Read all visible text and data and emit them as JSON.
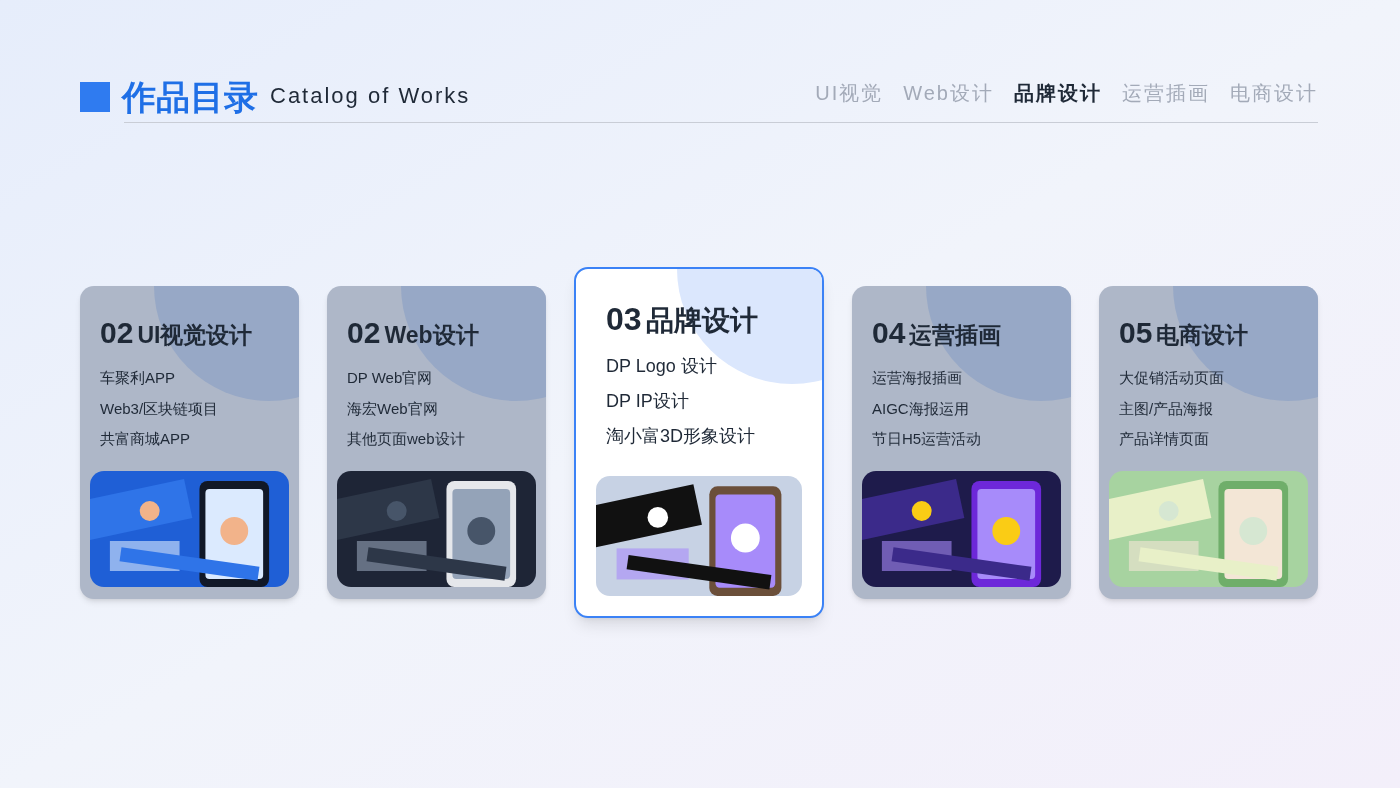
{
  "header": {
    "title": "作品目录",
    "subtitle": "Catalog of Works"
  },
  "tabs": [
    {
      "label": "UI视觉",
      "selected": false
    },
    {
      "label": "Web设计",
      "selected": false
    },
    {
      "label": "品牌设计",
      "selected": true
    },
    {
      "label": "运营插画",
      "selected": false
    },
    {
      "label": "电商设计",
      "selected": false
    }
  ],
  "cards": [
    {
      "number": "02",
      "title": "UI视觉设计",
      "selected": false,
      "items": [
        "车聚利APP",
        "Web3/区块链项目",
        "共富商城APP"
      ]
    },
    {
      "number": "02",
      "title": "Web设计",
      "selected": false,
      "items": [
        "DP Web官网",
        "海宏Web官网",
        "其他页面web设计"
      ]
    },
    {
      "number": "03",
      "title": "品牌设计",
      "selected": true,
      "items": [
        "DP Logo 设计",
        "DP IP设计",
        "淘小富3D形象设计"
      ]
    },
    {
      "number": "04",
      "title": "运营插画",
      "selected": false,
      "items": [
        "运营海报插画",
        "AIGC海报运用",
        "节日H5运营活动"
      ]
    },
    {
      "number": "05",
      "title": "电商设计",
      "selected": false,
      "items": [
        "大促销活动页面",
        "主图/产品海报",
        "产品详情页面"
      ]
    }
  ]
}
